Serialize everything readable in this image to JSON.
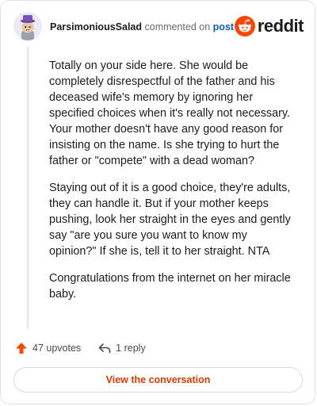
{
  "comment": {
    "username": "ParsimoniousSalad",
    "verb": "commented on",
    "post_link": "post",
    "paragraphs": [
      "Totally on your side here. She would be completely disrespectful of the father and his deceased wife's memory by ignoring her specified choices when it's really not necessary. Your mother doesn't have any good reason for insisting on the name. Is she trying to hurt the father or \"compete\" with a dead woman?",
      "Staying out of it is a good choice, they're adults, they can handle it. But if your mother keeps pushing, look her straight in the eyes and gently say \"are you sure you want to know my opinion?\" If she is, tell it to her straight. NTA",
      "Congratulations from the internet on her miracle baby."
    ],
    "upvotes_label": "47 upvotes",
    "replies_label": "1 reply"
  },
  "brand": {
    "logo_text": "reddit",
    "accent": "#ff4500"
  },
  "actions": {
    "view_conversation": "View the conversation"
  },
  "icons": [
    "avatar",
    "reddit-logo-icon",
    "upvote-arrow-icon",
    "reply-arrow-icon"
  ]
}
